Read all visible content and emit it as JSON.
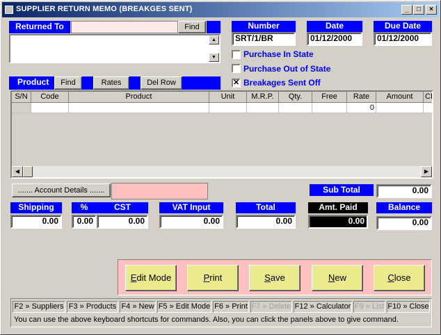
{
  "window": {
    "title": "SUPPLIER RETURN MEMO (BREAKGES SENT)"
  },
  "returned_to": {
    "label": "Returned To",
    "value": "",
    "find_label": "Find",
    "address": ""
  },
  "number": {
    "label": "Number",
    "value": "SRT/1/BR"
  },
  "date": {
    "label": "Date",
    "value": "01/12/2000"
  },
  "due_date": {
    "label": "Due Date",
    "value": "01/12/2000"
  },
  "options": {
    "purchase_in_state": {
      "label": "Purchase In State",
      "checked": false
    },
    "purchase_out_of_state": {
      "label": "Purchase Out of State",
      "checked": false
    },
    "breakages_sent_off": {
      "label": "Breakages Sent Off",
      "checked": true,
      "mark": "✕"
    }
  },
  "product_bar": {
    "label": "Product",
    "find": "Find",
    "rates": "Rates",
    "del_row": "Del Row"
  },
  "grid": {
    "columns": [
      "S/N",
      "Code",
      "Product",
      "Unit",
      "M.R.P.",
      "Qty.",
      "Free",
      "Rate",
      "Amount",
      "CP"
    ],
    "rows": [
      [
        "",
        "",
        "",
        "",
        "",
        "",
        "",
        "0",
        "",
        ""
      ]
    ]
  },
  "account_details_label": "....... Account Details .......",
  "sub_total": {
    "label": "Sub Total",
    "value": "0.00"
  },
  "totals": {
    "shipping": {
      "label": "Shipping",
      "value": "0.00"
    },
    "pct": {
      "label": "%",
      "value": "0.00"
    },
    "cst": {
      "label": "CST",
      "value": "0.00"
    },
    "vat_input": {
      "label": "VAT Input",
      "value": "0.00"
    },
    "total": {
      "label": "Total",
      "value": "0.00"
    },
    "amt_paid": {
      "label": "Amt. Paid",
      "value": "0.00"
    },
    "balance": {
      "label": "Balance",
      "value": "0.00"
    }
  },
  "actions": {
    "edit_mode": "Edit Mode",
    "print": "Print",
    "save": "Save",
    "new": "New",
    "close": "Close"
  },
  "shortcuts": [
    {
      "label": "F2 » Suppliers",
      "enabled": true
    },
    {
      "label": "F3 » Products",
      "enabled": true
    },
    {
      "label": "F4 » New",
      "enabled": true
    },
    {
      "label": "F5 » Edit Mode",
      "enabled": true
    },
    {
      "label": "F6 » Print",
      "enabled": true
    },
    {
      "label": "F7 » Delete",
      "enabled": false
    },
    {
      "label": "F12 » Calculator",
      "enabled": true
    },
    {
      "label": "F9 » List",
      "enabled": false
    },
    {
      "label": "F10 » Close",
      "enabled": true
    }
  ],
  "hint": "You can use the above keyboard shortcuts for commands. Also, you can click the panels above to give command.",
  "colors": {
    "label_blue": "#0000ff",
    "pink": "#ffc0c0",
    "button_yellow": "#ebeb8e"
  }
}
